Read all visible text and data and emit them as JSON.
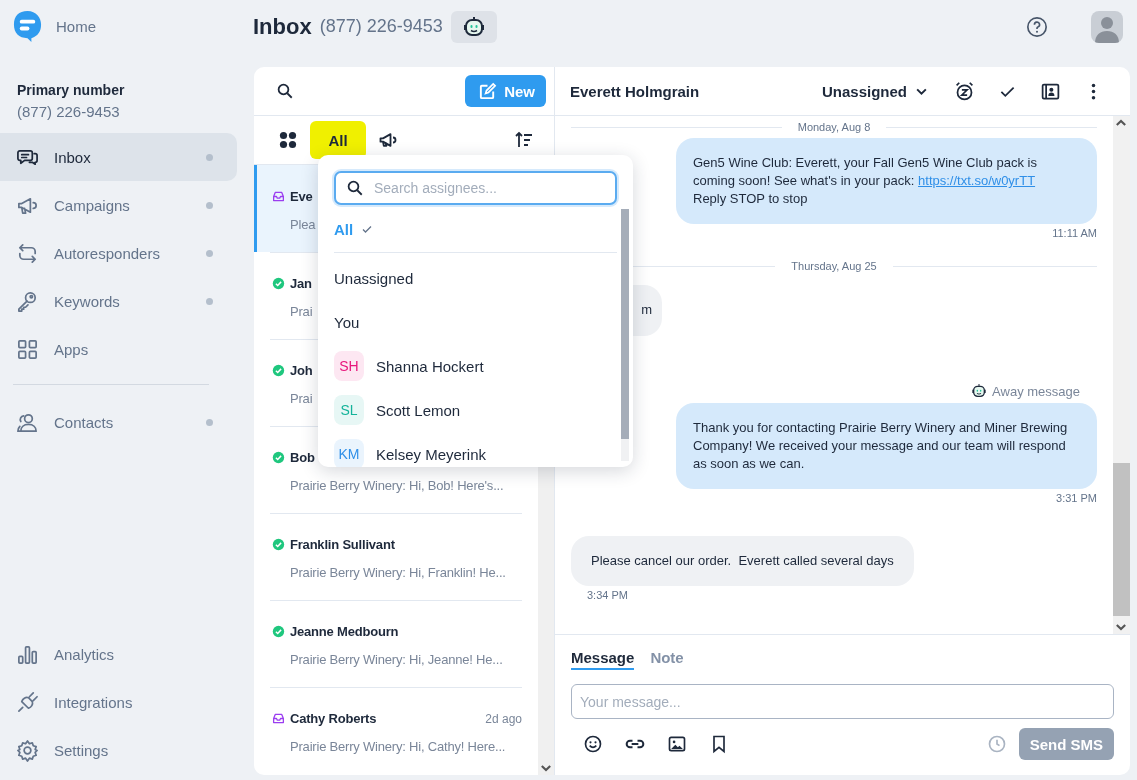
{
  "brand": {
    "home_label": "Home"
  },
  "header": {
    "title": "Inbox",
    "phone": "(877) 226-9453"
  },
  "sidebar": {
    "primary_label": "Primary number",
    "primary_number": "(877) 226-9453",
    "items": [
      {
        "label": "Inbox",
        "selected": true,
        "dot": true
      },
      {
        "label": "Campaigns",
        "selected": false,
        "dot": true
      },
      {
        "label": "Autoresponders",
        "selected": false,
        "dot": true
      },
      {
        "label": "Keywords",
        "selected": false,
        "dot": true
      },
      {
        "label": "Apps",
        "selected": false,
        "dot": false
      },
      {
        "label": "Contacts",
        "selected": false,
        "dot": true
      }
    ],
    "bottom_items": [
      {
        "label": "Analytics",
        "selected": false
      },
      {
        "label": "Integrations",
        "selected": false
      },
      {
        "label": "Settings",
        "selected": false
      }
    ]
  },
  "conversation_list": {
    "new_button": "New",
    "filters": [
      {
        "kind": "icon",
        "selected": false
      },
      {
        "kind": "text",
        "label": "All",
        "selected": true
      },
      {
        "kind": "icon",
        "selected": false
      }
    ],
    "conversations": [
      {
        "name": "Eve",
        "preview": "Plea",
        "kind": "open",
        "selected": true
      },
      {
        "name": "Jan",
        "preview": "Prai",
        "kind": "closed",
        "selected": false
      },
      {
        "name": "Joh",
        "preview": "Prai",
        "kind": "closed",
        "selected": false
      },
      {
        "name": "Bob",
        "preview": "Prairie Berry Winery: Hi, Bob! Here's...",
        "kind": "closed",
        "selected": false
      },
      {
        "name": "Franklin Sullivant",
        "preview": "Prairie Berry Winery: Hi, Franklin! He...",
        "kind": "closed",
        "selected": false
      },
      {
        "name": "Jeanne Medbourn",
        "preview": "Prairie Berry Winery: Hi, Jeanne! He...",
        "kind": "closed",
        "selected": false
      },
      {
        "name": "Cathy Roberts",
        "time": "2d ago",
        "preview": "Prairie Berry Winery: Hi, Cathy! Here...",
        "kind": "open",
        "selected": false
      }
    ]
  },
  "assignee_menu": {
    "placeholder": "Search assignees...",
    "options": [
      {
        "label": "All",
        "selected": true,
        "kind": "plain"
      },
      {
        "label": "Unassigned",
        "selected": false,
        "kind": "plain"
      },
      {
        "label": "You",
        "selected": false,
        "kind": "plain"
      },
      {
        "label": "Shanna Hockert",
        "initials": "SH",
        "color": "#e8157c",
        "selected": false,
        "kind": "person"
      },
      {
        "label": "Scott Lemon",
        "initials": "SL",
        "color": "#14b39a",
        "selected": false,
        "kind": "person"
      },
      {
        "label": "Kelsey Meyerink",
        "initials": "KM",
        "color": "#2f8fe8",
        "selected": false,
        "kind": "person"
      }
    ]
  },
  "chat": {
    "contact_name": "Everett Holmgrain",
    "assignee": "Unassigned",
    "messages": [
      {
        "kind": "date",
        "text": "Monday, Aug 8"
      },
      {
        "kind": "outgoing",
        "text": "Gen5 Wine Club: Everett, your Fall Gen5 Wine Club pack is coming soon! See what's in your pack: ",
        "link": "https://txt.so/w0yrTT",
        "text_after": "Reply STOP to stop",
        "time": "11:11 AM"
      },
      {
        "kind": "date",
        "text": "Thursday, Aug 25"
      },
      {
        "kind": "incoming",
        "text": "m"
      },
      {
        "kind": "outgoing",
        "label": "Away message",
        "text": "Thank you for contacting Prairie Berry Winery and Miner Brewing Company! We received your message and our team will respond as soon as we can.",
        "time": "3:31 PM"
      },
      {
        "kind": "incoming",
        "text": "Please cancel our order.  Everett called several days",
        "time": "3:34 PM"
      }
    ],
    "composer": {
      "tabs": [
        {
          "label": "Message",
          "selected": true
        },
        {
          "label": "Note",
          "selected": false
        }
      ],
      "placeholder": "Your message...",
      "send_button": "Send SMS",
      "send_disabled": true
    }
  }
}
